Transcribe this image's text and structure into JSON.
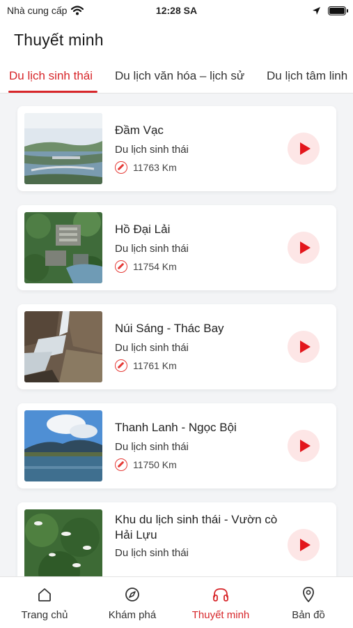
{
  "status": {
    "carrier": "Nhà cung cấp",
    "time": "12:28 SA"
  },
  "header": {
    "title": "Thuyết minh"
  },
  "tabs": [
    {
      "label": "Du lịch sinh thái",
      "active": true
    },
    {
      "label": "Du lịch văn hóa – lịch sử",
      "active": false
    },
    {
      "label": "Du lịch tâm linh",
      "active": false
    }
  ],
  "places": [
    {
      "name": "Đầm Vạc",
      "category": "Du lịch sinh thái",
      "distance": "11763 Km",
      "image": "lake-city-aerial"
    },
    {
      "name": "Hồ Đại Lải",
      "category": "Du lịch sinh thái",
      "distance": "11754 Km",
      "image": "resort-forest-aerial"
    },
    {
      "name": "Núi Sáng - Thác Bay",
      "category": "Du lịch sinh thái",
      "distance": "11761 Km",
      "image": "waterfall-rocks"
    },
    {
      "name": "Thanh Lanh - Ngọc Bội",
      "category": "Du lịch sinh thái",
      "distance": "11750 Km",
      "image": "mountain-lake"
    },
    {
      "name": "Khu du lịch sinh thái - Vườn cò Hải Lựu",
      "category": "Du lịch sinh thái",
      "distance": "",
      "image": "storks-forest"
    }
  ],
  "bottom_nav": [
    {
      "label": "Trang chủ",
      "icon": "home-icon",
      "active": false
    },
    {
      "label": "Khám phá",
      "icon": "explore-icon",
      "active": false
    },
    {
      "label": "Thuyết minh",
      "icon": "headphones-icon",
      "active": true
    },
    {
      "label": "Bản đồ",
      "icon": "map-pin-icon",
      "active": false
    }
  ],
  "colors": {
    "accent": "#d7262a",
    "play_bg": "#fde6e6",
    "background": "#f3f4f6"
  }
}
